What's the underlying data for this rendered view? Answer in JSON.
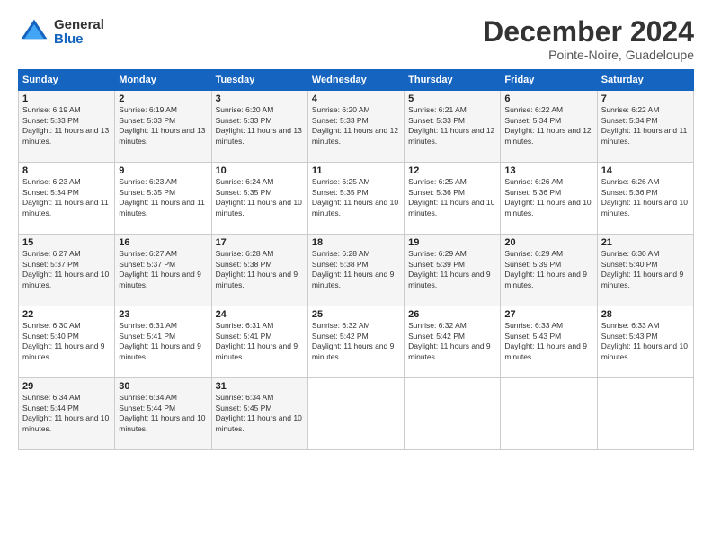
{
  "logo": {
    "general": "General",
    "blue": "Blue"
  },
  "title": "December 2024",
  "subtitle": "Pointe-Noire, Guadeloupe",
  "weekdays": [
    "Sunday",
    "Monday",
    "Tuesday",
    "Wednesday",
    "Thursday",
    "Friday",
    "Saturday"
  ],
  "weeks": [
    [
      {
        "day": "1",
        "sunrise": "6:19 AM",
        "sunset": "5:33 PM",
        "daylight": "11 hours and 13 minutes."
      },
      {
        "day": "2",
        "sunrise": "6:19 AM",
        "sunset": "5:33 PM",
        "daylight": "11 hours and 13 minutes."
      },
      {
        "day": "3",
        "sunrise": "6:20 AM",
        "sunset": "5:33 PM",
        "daylight": "11 hours and 13 minutes."
      },
      {
        "day": "4",
        "sunrise": "6:20 AM",
        "sunset": "5:33 PM",
        "daylight": "11 hours and 12 minutes."
      },
      {
        "day": "5",
        "sunrise": "6:21 AM",
        "sunset": "5:33 PM",
        "daylight": "11 hours and 12 minutes."
      },
      {
        "day": "6",
        "sunrise": "6:22 AM",
        "sunset": "5:34 PM",
        "daylight": "11 hours and 12 minutes."
      },
      {
        "day": "7",
        "sunrise": "6:22 AM",
        "sunset": "5:34 PM",
        "daylight": "11 hours and 11 minutes."
      }
    ],
    [
      {
        "day": "8",
        "sunrise": "6:23 AM",
        "sunset": "5:34 PM",
        "daylight": "11 hours and 11 minutes."
      },
      {
        "day": "9",
        "sunrise": "6:23 AM",
        "sunset": "5:35 PM",
        "daylight": "11 hours and 11 minutes."
      },
      {
        "day": "10",
        "sunrise": "6:24 AM",
        "sunset": "5:35 PM",
        "daylight": "11 hours and 10 minutes."
      },
      {
        "day": "11",
        "sunrise": "6:25 AM",
        "sunset": "5:35 PM",
        "daylight": "11 hours and 10 minutes."
      },
      {
        "day": "12",
        "sunrise": "6:25 AM",
        "sunset": "5:36 PM",
        "daylight": "11 hours and 10 minutes."
      },
      {
        "day": "13",
        "sunrise": "6:26 AM",
        "sunset": "5:36 PM",
        "daylight": "11 hours and 10 minutes."
      },
      {
        "day": "14",
        "sunrise": "6:26 AM",
        "sunset": "5:36 PM",
        "daylight": "11 hours and 10 minutes."
      }
    ],
    [
      {
        "day": "15",
        "sunrise": "6:27 AM",
        "sunset": "5:37 PM",
        "daylight": "11 hours and 10 minutes."
      },
      {
        "day": "16",
        "sunrise": "6:27 AM",
        "sunset": "5:37 PM",
        "daylight": "11 hours and 9 minutes."
      },
      {
        "day": "17",
        "sunrise": "6:28 AM",
        "sunset": "5:38 PM",
        "daylight": "11 hours and 9 minutes."
      },
      {
        "day": "18",
        "sunrise": "6:28 AM",
        "sunset": "5:38 PM",
        "daylight": "11 hours and 9 minutes."
      },
      {
        "day": "19",
        "sunrise": "6:29 AM",
        "sunset": "5:39 PM",
        "daylight": "11 hours and 9 minutes."
      },
      {
        "day": "20",
        "sunrise": "6:29 AM",
        "sunset": "5:39 PM",
        "daylight": "11 hours and 9 minutes."
      },
      {
        "day": "21",
        "sunrise": "6:30 AM",
        "sunset": "5:40 PM",
        "daylight": "11 hours and 9 minutes."
      }
    ],
    [
      {
        "day": "22",
        "sunrise": "6:30 AM",
        "sunset": "5:40 PM",
        "daylight": "11 hours and 9 minutes."
      },
      {
        "day": "23",
        "sunrise": "6:31 AM",
        "sunset": "5:41 PM",
        "daylight": "11 hours and 9 minutes."
      },
      {
        "day": "24",
        "sunrise": "6:31 AM",
        "sunset": "5:41 PM",
        "daylight": "11 hours and 9 minutes."
      },
      {
        "day": "25",
        "sunrise": "6:32 AM",
        "sunset": "5:42 PM",
        "daylight": "11 hours and 9 minutes."
      },
      {
        "day": "26",
        "sunrise": "6:32 AM",
        "sunset": "5:42 PM",
        "daylight": "11 hours and 9 minutes."
      },
      {
        "day": "27",
        "sunrise": "6:33 AM",
        "sunset": "5:43 PM",
        "daylight": "11 hours and 9 minutes."
      },
      {
        "day": "28",
        "sunrise": "6:33 AM",
        "sunset": "5:43 PM",
        "daylight": "11 hours and 10 minutes."
      }
    ],
    [
      {
        "day": "29",
        "sunrise": "6:34 AM",
        "sunset": "5:44 PM",
        "daylight": "11 hours and 10 minutes."
      },
      {
        "day": "30",
        "sunrise": "6:34 AM",
        "sunset": "5:44 PM",
        "daylight": "11 hours and 10 minutes."
      },
      {
        "day": "31",
        "sunrise": "6:34 AM",
        "sunset": "5:45 PM",
        "daylight": "11 hours and 10 minutes."
      },
      null,
      null,
      null,
      null
    ]
  ]
}
